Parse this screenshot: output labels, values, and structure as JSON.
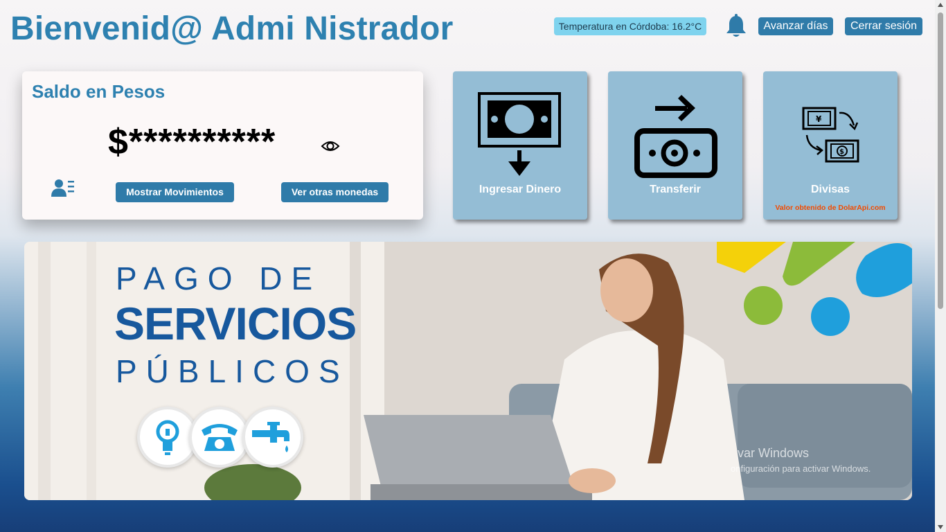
{
  "header": {
    "title": "Bienvenid@ Admi Nistrador",
    "temperature_text": "Temperatura en Córdoba: 16.2°C",
    "bell_icon": "bell-icon",
    "advance_days_label": "Avanzar días",
    "logout_label": "Cerrar sesión"
  },
  "balance_card": {
    "title": "Saldo en Pesos",
    "masked_amount": "$**********",
    "eye_icon": "eye-icon",
    "contacts_icon": "user-list-icon",
    "show_movements_label": "Mostrar Movimientos",
    "other_currencies_label": "Ver otras monedas"
  },
  "actions": [
    {
      "label": "Ingresar Dinero",
      "icon": "cash-deposit-icon"
    },
    {
      "label": "Transferir",
      "icon": "money-transfer-icon"
    },
    {
      "label": "Divisas",
      "icon": "currency-exchange-icon",
      "note": "Valor obtenido de DolarApi.com"
    }
  ],
  "banner": {
    "line1": "PAGO DE",
    "line2": "SERVICIOS",
    "line3": "PÚBLICOS",
    "service_icons": [
      "light-bulb-icon",
      "telephone-icon",
      "water-tap-icon"
    ],
    "watermark_title": "var Windows",
    "watermark_subtitle": "onfiguración para activar Windows."
  },
  "colors": {
    "accent": "#2e81b0",
    "button": "#2f7ba9",
    "tile": "#94bdd5",
    "temp_badge": "#7fd3ee",
    "note": "#f24b00",
    "banner_text": "#17589d"
  }
}
